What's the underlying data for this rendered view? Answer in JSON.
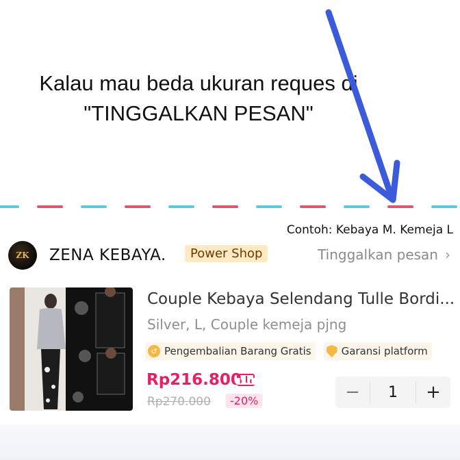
{
  "instruction": {
    "line1": "Kalau mau beda ukuran reques di",
    "line2": "\"TINGGALKAN PESAN\""
  },
  "example_label": "Contoh: Kebaya M. Kemeja L",
  "shop": {
    "logo_text": "ZK",
    "name": "ZENA KEBAYA.",
    "badge": "Power Shop",
    "leave_message": "Tinggalkan pesan",
    "chevron": "›"
  },
  "product": {
    "title": "Couple Kebaya Selendang Tulle Bordi...",
    "variant": "Silver, L, Couple kemeja pjng",
    "tags": [
      "Pengembalian Barang Gratis",
      "Garansi platform"
    ],
    "price": "Rp216.800",
    "old_price": "Rp270.000",
    "discount": "-20%",
    "quantity": "1",
    "minus": "−",
    "plus": "+"
  },
  "colors": {
    "accent_pink": "#e91e63",
    "arrow_blue": "#3b5bdb",
    "badge_bg": "#fde9c4",
    "airmail_red": "#e0566c",
    "airmail_cyan": "#5bc8de"
  },
  "icons": [
    "arrow-down-right-icon",
    "chevron-right-icon",
    "return-badge-icon",
    "shield-icon",
    "coupon-icon",
    "minus-icon",
    "plus-icon"
  ]
}
